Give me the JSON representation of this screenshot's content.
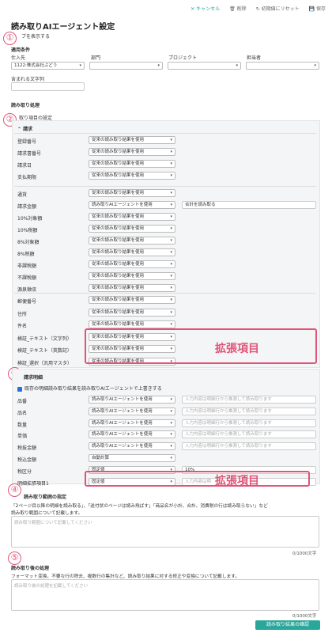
{
  "toolbar": {
    "cancel": "キャンセル",
    "delete": "削除",
    "reset": "初期値にリセット",
    "save": "保存"
  },
  "title": "読み取りAIエージェント設定",
  "toggle_link": "ブを表示する",
  "badges": [
    "①",
    "②",
    "③",
    "④",
    "⑤"
  ],
  "conditions": {
    "heading": "適用条件",
    "supplier_label": "仕入先",
    "supplier_value": "1122:株式会社ぶどう",
    "dept_label": "部門",
    "project_label": "プロジェクト",
    "owner_label": "担当者",
    "contains_label": "含まれる文字列"
  },
  "processing": {
    "heading": "読み取り処理",
    "items_label": "取り項目の設定",
    "invoice_heading": "請求",
    "group1": [
      {
        "label": "登録番号",
        "value": "従来の読み取り結果を使用"
      },
      {
        "label": "請求書番号",
        "value": "従来の読み取り結果を使用"
      },
      {
        "label": "請求日",
        "value": "従来の読み取り結果を使用"
      },
      {
        "label": "支払期限",
        "value": "従来の読み取り結果を使用"
      }
    ],
    "group2": [
      {
        "label": "通貨",
        "value": "従来の読み取り結果を使用"
      },
      {
        "label": "請求金額",
        "value": "読み取りAIエージェントを使用",
        "extra": "合計を読み取る"
      },
      {
        "label": "10%対象額",
        "value": "従来の読み取り結果を使用"
      },
      {
        "label": "10%税額",
        "value": "従来の読み取り結果を使用"
      },
      {
        "label": "8%対象額",
        "value": "従来の読み取り結果を使用"
      },
      {
        "label": "8%税額",
        "value": "従来の読み取り結果を使用"
      },
      {
        "label": "非課税額",
        "value": "従来の読み取り結果を使用"
      },
      {
        "label": "不課税額",
        "value": "従来の読み取り結果を使用"
      },
      {
        "label": "源泉徴収",
        "value": "従来の読み取り結果を使用"
      }
    ],
    "group3": [
      {
        "label": "郵便番号",
        "value": "従来の読み取り結果を使用"
      },
      {
        "label": "住所",
        "value": "従来の読み取り結果を使用"
      },
      {
        "label": "件名",
        "value": "従来の読み取り結果を使用"
      },
      {
        "label": "検証_テキスト（文字列）",
        "value": "従来の読み取り結果を使用"
      },
      {
        "label": "検証_テキスト（英数記）",
        "value": "従来の読み取り結果を使用"
      },
      {
        "label": "検証_選択（汎用マスタ）",
        "value": "従来の読み取り結果を使用"
      }
    ],
    "extension_label": "拡張項目",
    "details_heading": "請求明細",
    "details_checkbox": "既存の明細読み取り結果を読み取りAIエージェントで上書きする",
    "details": [
      {
        "label": "品番",
        "value": "読み取りAIエージェントを使用",
        "placeholder": "入力内容は明細行から推測して読み取ります"
      },
      {
        "label": "品名",
        "value": "読み取りAIエージェントを使用",
        "placeholder": "入力内容は明細行から推測して読み取ります"
      },
      {
        "label": "数量",
        "value": "読み取りAIエージェントを使用",
        "placeholder": "入力内容は明細行から推測して読み取ります"
      },
      {
        "label": "単価",
        "value": "読み取りAIエージェントを使用",
        "placeholder": "入力内容は明細行から推測して読み取ります"
      },
      {
        "label": "税抜金額",
        "value": "読み取りAIエージェントを使用",
        "placeholder": "入力内容は明細行から推測して読み取ります"
      },
      {
        "label": "税込金額",
        "value": "自動計算"
      },
      {
        "label": "税区分",
        "value": "固定値",
        "extra": "10%"
      },
      {
        "label": "明細拡張項目1",
        "value": "固定値",
        "placeholder": "入力内容は明"
      }
    ]
  },
  "range": {
    "heading": "読み取り範囲の指定",
    "desc1": "「2ページ目以降の明細を読み取る」、「送付状のページは読み飛ばす」「商品名が小計、合計、消費税の行は読み取らない」など",
    "desc2": "読み取り範囲について記載します。",
    "placeholder": "読み取り範囲について記載してください",
    "counter": "0/1000文字"
  },
  "post": {
    "heading": "読み取り後の処理",
    "desc": "フォーマット変換、不要な行の除去、複数行の集計など、読み取り結果に対する修正や変換について記載します。",
    "placeholder": "読み取り後の処理を記載してください",
    "counter": "0/1000文字",
    "confirm_button": "読み取り結果の確認"
  }
}
